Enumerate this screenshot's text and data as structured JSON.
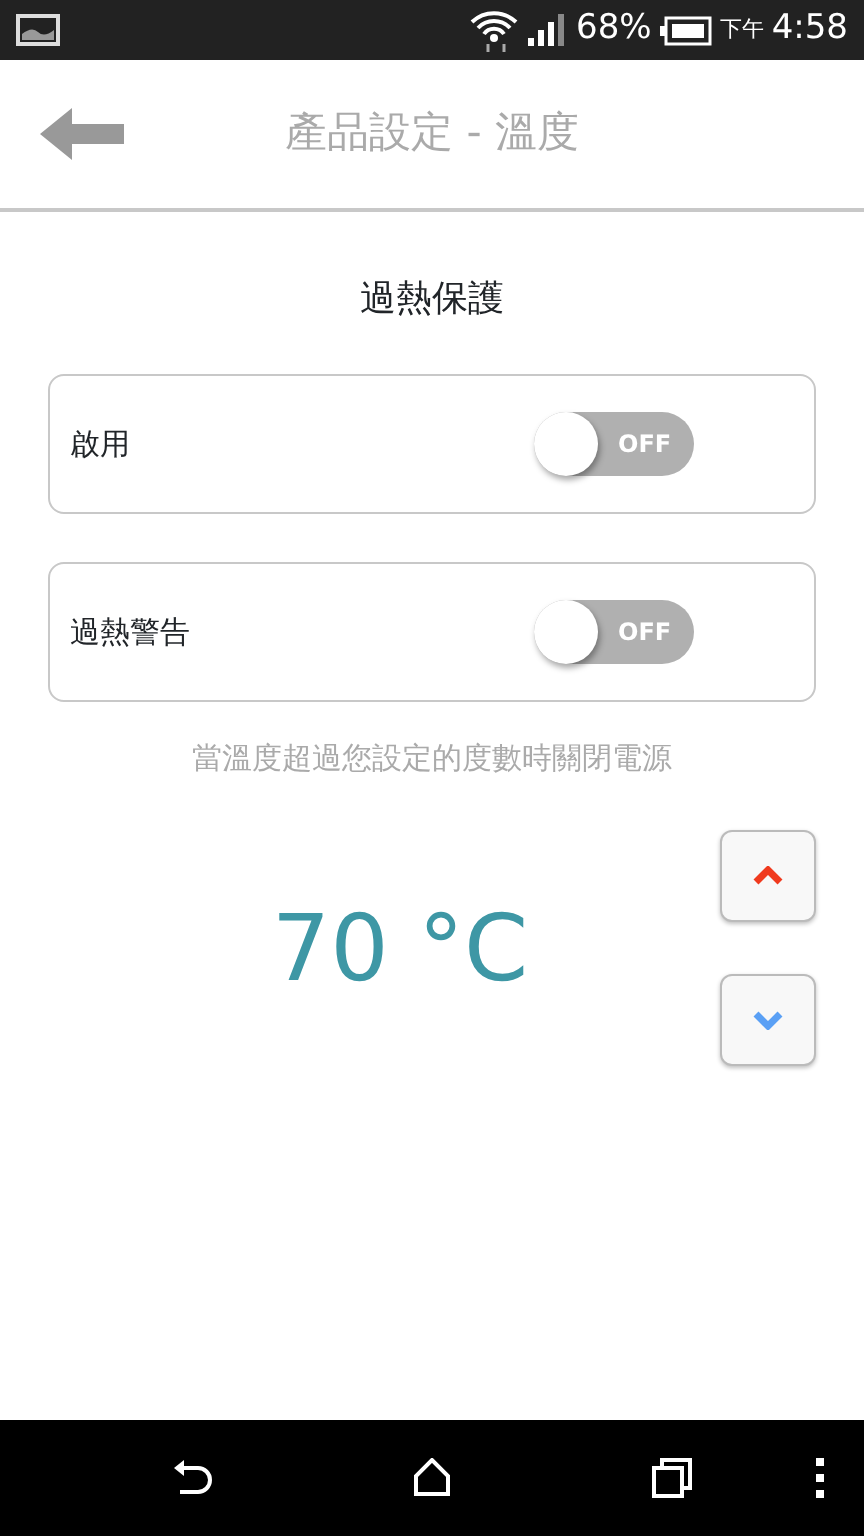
{
  "status_bar": {
    "battery_percent": "68%",
    "time_prefix": "下午",
    "time": "4:58"
  },
  "header": {
    "title": "產品設定 - 溫度"
  },
  "section_title": "過熱保護",
  "settings": [
    {
      "label": "啟用",
      "on": false,
      "switch_text": "OFF"
    },
    {
      "label": "過熱警告",
      "on": false,
      "switch_text": "OFF"
    }
  ],
  "hint": "當溫度超過您設定的度數時關閉電源",
  "temperature": {
    "value": "70 °C"
  }
}
